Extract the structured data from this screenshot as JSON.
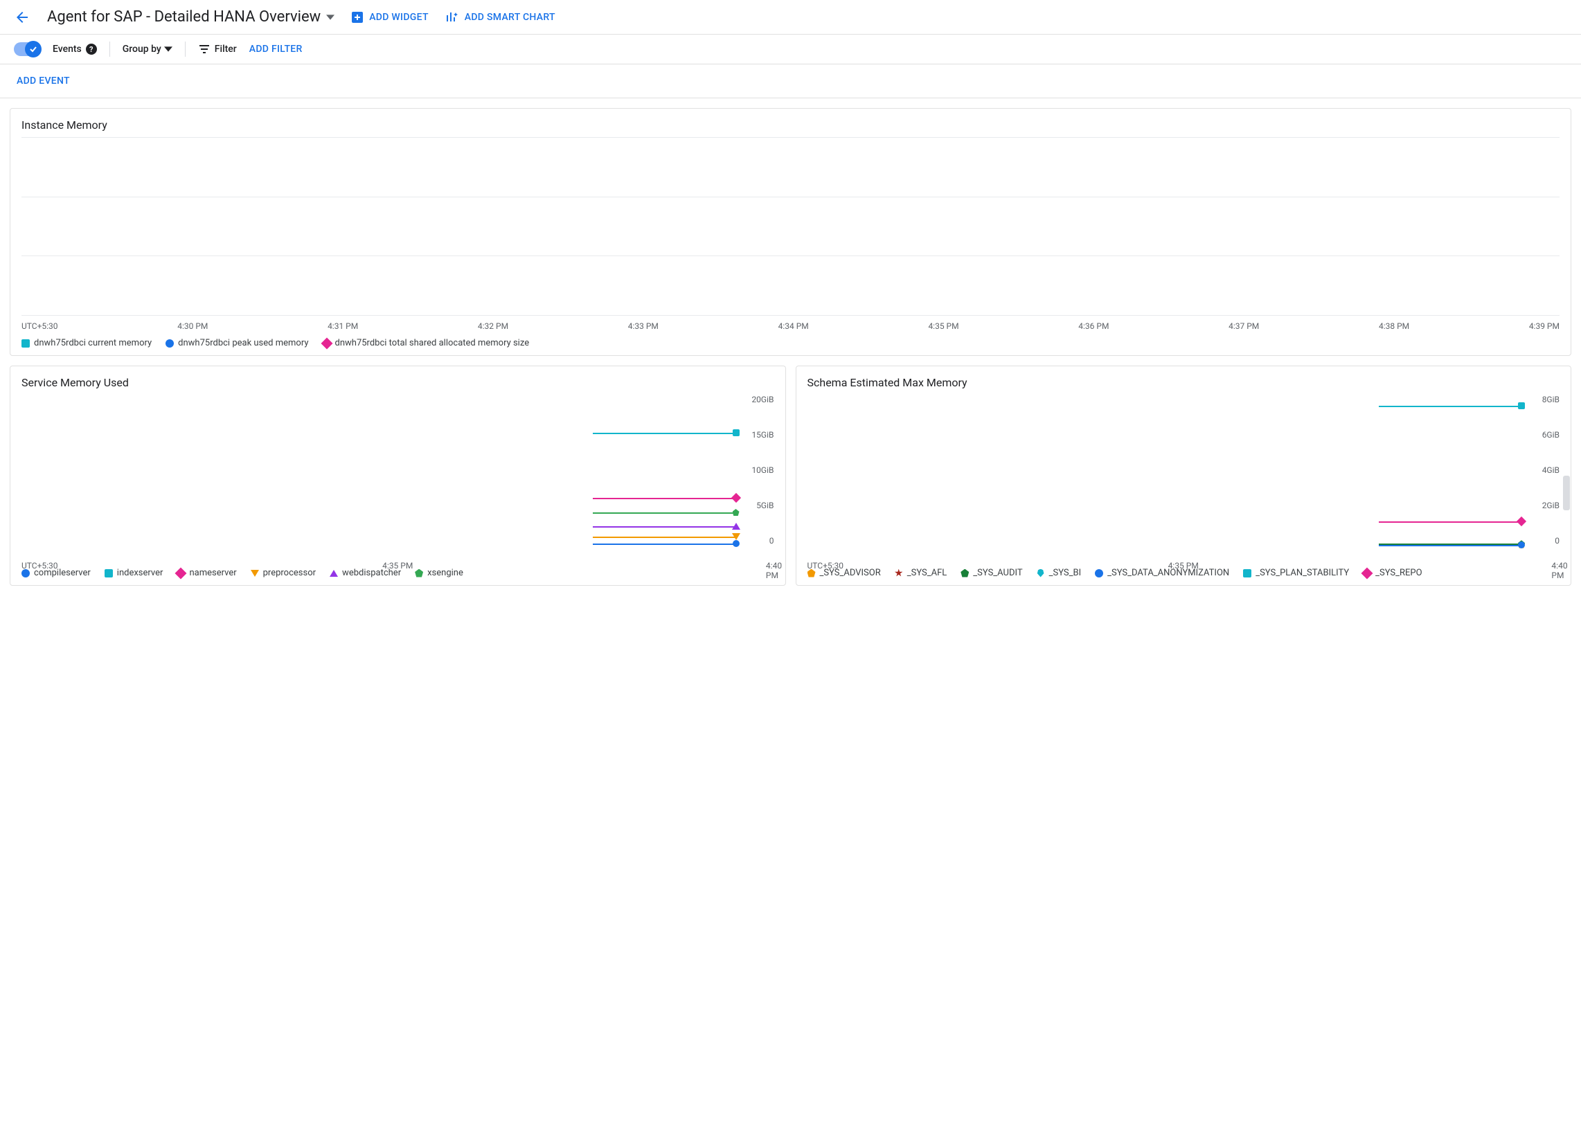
{
  "header": {
    "title": "Agent for SAP - Detailed HANA Overview",
    "add_widget": "ADD WIDGET",
    "add_smart_chart": "ADD SMART CHART"
  },
  "toolbar": {
    "events": "Events",
    "group_by": "Group by",
    "filter": "Filter",
    "add_filter": "ADD FILTER"
  },
  "sub_toolbar": {
    "add_event": "ADD EVENT"
  },
  "chart_data": [
    {
      "id": "instance_memory",
      "type": "line",
      "title": "Instance Memory",
      "timezone": "UTC+5:30",
      "x_ticks": [
        "4:30 PM",
        "4:31 PM",
        "4:32 PM",
        "4:33 PM",
        "4:34 PM",
        "4:35 PM",
        "4:36 PM",
        "4:37 PM",
        "4:38 PM",
        "4:39 PM"
      ],
      "y_ticks": [],
      "series": [
        {
          "name": "dnwh75rdbci current memory",
          "color": "#12b5cb",
          "marker": "square",
          "values": []
        },
        {
          "name": "dnwh75rdbci peak used memory",
          "color": "#1a73e8",
          "marker": "circle",
          "values": []
        },
        {
          "name": "dnwh75rdbci total shared allocated memory size",
          "color": "#e52592",
          "marker": "diamond",
          "values": []
        }
      ]
    },
    {
      "id": "service_memory_used",
      "type": "line",
      "title": "Service Memory Used",
      "timezone": "UTC+5:30",
      "x_ticks": [
        "4:35 PM",
        "4:40 PM"
      ],
      "y_ticks": [
        "20GiB",
        "15GiB",
        "10GiB",
        "5GiB",
        "0"
      ],
      "ylim": [
        0,
        20
      ],
      "x_span_minutes": 10,
      "x_start": "4:30",
      "data_start_min": 8,
      "data_end_min": 10,
      "series": [
        {
          "name": "compileserver",
          "color": "#1a73e8",
          "marker": "circle",
          "value_gib": 0.3
        },
        {
          "name": "indexserver",
          "color": "#12b5cb",
          "marker": "square",
          "value_gib": 15.0
        },
        {
          "name": "nameserver",
          "color": "#e52592",
          "marker": "diamond",
          "value_gib": 6.3
        },
        {
          "name": "preprocessor",
          "color": "#f29900",
          "marker": "triangle-down",
          "value_gib": 1.2
        },
        {
          "name": "webdispatcher",
          "color": "#9334e6",
          "marker": "triangle-up",
          "value_gib": 2.6
        },
        {
          "name": "xsengine",
          "color": "#34a853",
          "marker": "pentagon",
          "value_gib": 4.4
        }
      ]
    },
    {
      "id": "schema_est_max_memory",
      "type": "line",
      "title": "Schema Estimated Max Memory",
      "timezone": "UTC+5:30",
      "x_ticks": [
        "4:35 PM",
        "4:40 PM"
      ],
      "y_ticks": [
        "8GiB",
        "6GiB",
        "4GiB",
        "2GiB",
        "0"
      ],
      "ylim": [
        0,
        8
      ],
      "x_span_minutes": 10,
      "x_start": "4:30",
      "data_start_min": 8,
      "data_end_min": 10,
      "series": [
        {
          "name": "_SYS_ADVISOR",
          "color": "#f29900",
          "marker": "pentagon",
          "value_gib": 0.05
        },
        {
          "name": "_SYS_AFL",
          "color": "#a8281f",
          "marker": "star",
          "value_gib": 0.05
        },
        {
          "name": "_SYS_AUDIT",
          "color": "#188038",
          "marker": "pentagon",
          "value_gib": 0.1
        },
        {
          "name": "_SYS_BI",
          "color": "#12b5cb",
          "marker": "drop",
          "value_gib": 0.05
        },
        {
          "name": "_SYS_DATA_ANONYMIZATION",
          "color": "#1a73e8",
          "marker": "circle",
          "value_gib": 0.05
        },
        {
          "name": "_SYS_PLAN_STABILITY",
          "color": "#12b5cb",
          "marker": "square",
          "value_gib": 7.4
        },
        {
          "name": "_SYS_REPO",
          "color": "#e52592",
          "marker": "diamond",
          "value_gib": 1.3
        }
      ]
    }
  ]
}
